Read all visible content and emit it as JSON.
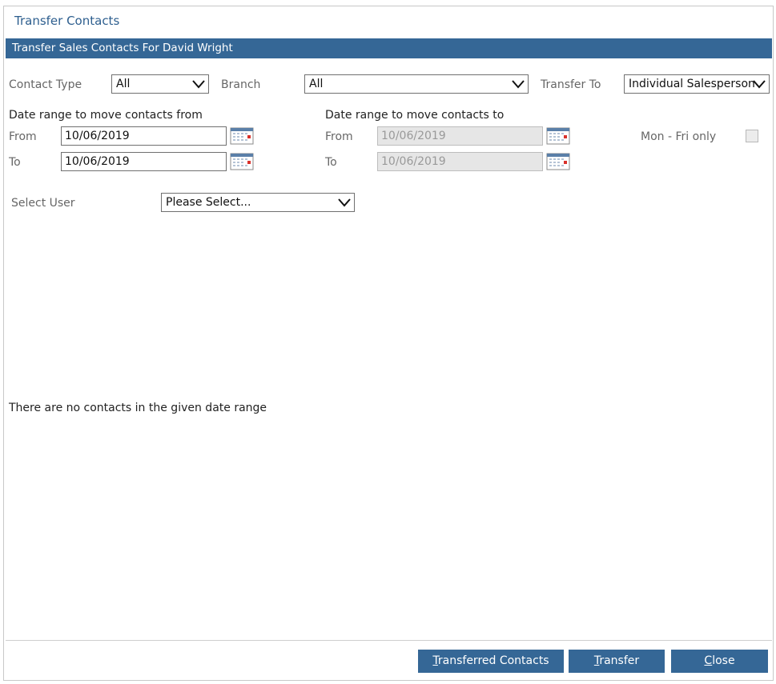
{
  "dialog": {
    "title": "Transfer Contacts",
    "section_header": "Transfer Sales Contacts For David Wright"
  },
  "filters": {
    "contact_type_label": "Contact Type",
    "contact_type_value": "All",
    "branch_label": "Branch",
    "branch_value": "All",
    "transfer_to_label": "Transfer To",
    "transfer_to_value": "Individual Salesperson"
  },
  "date_from_range": {
    "heading": "Date range to move contacts from",
    "from_label": "From",
    "from_value": "10/06/2019",
    "to_label": "To",
    "to_value": "10/06/2019"
  },
  "date_to_range": {
    "heading": "Date range to move contacts to",
    "from_label": "From",
    "from_value": "10/06/2019",
    "to_label": "To",
    "to_value": "10/06/2019",
    "mon_fri_label": "Mon - Fri only",
    "mon_fri_checked": false
  },
  "user": {
    "label": "Select User",
    "value": "Please Select..."
  },
  "results": {
    "empty_message": "There are no contacts in the given date range"
  },
  "buttons": {
    "transferred_contacts_first": "T",
    "transferred_contacts_rest": "ransferred Contacts",
    "transfer_first": "T",
    "transfer_rest": "ransfer",
    "close_first": "C",
    "close_rest": "lose"
  },
  "colors": {
    "accent": "#356796",
    "title": "#2e5f8f"
  }
}
